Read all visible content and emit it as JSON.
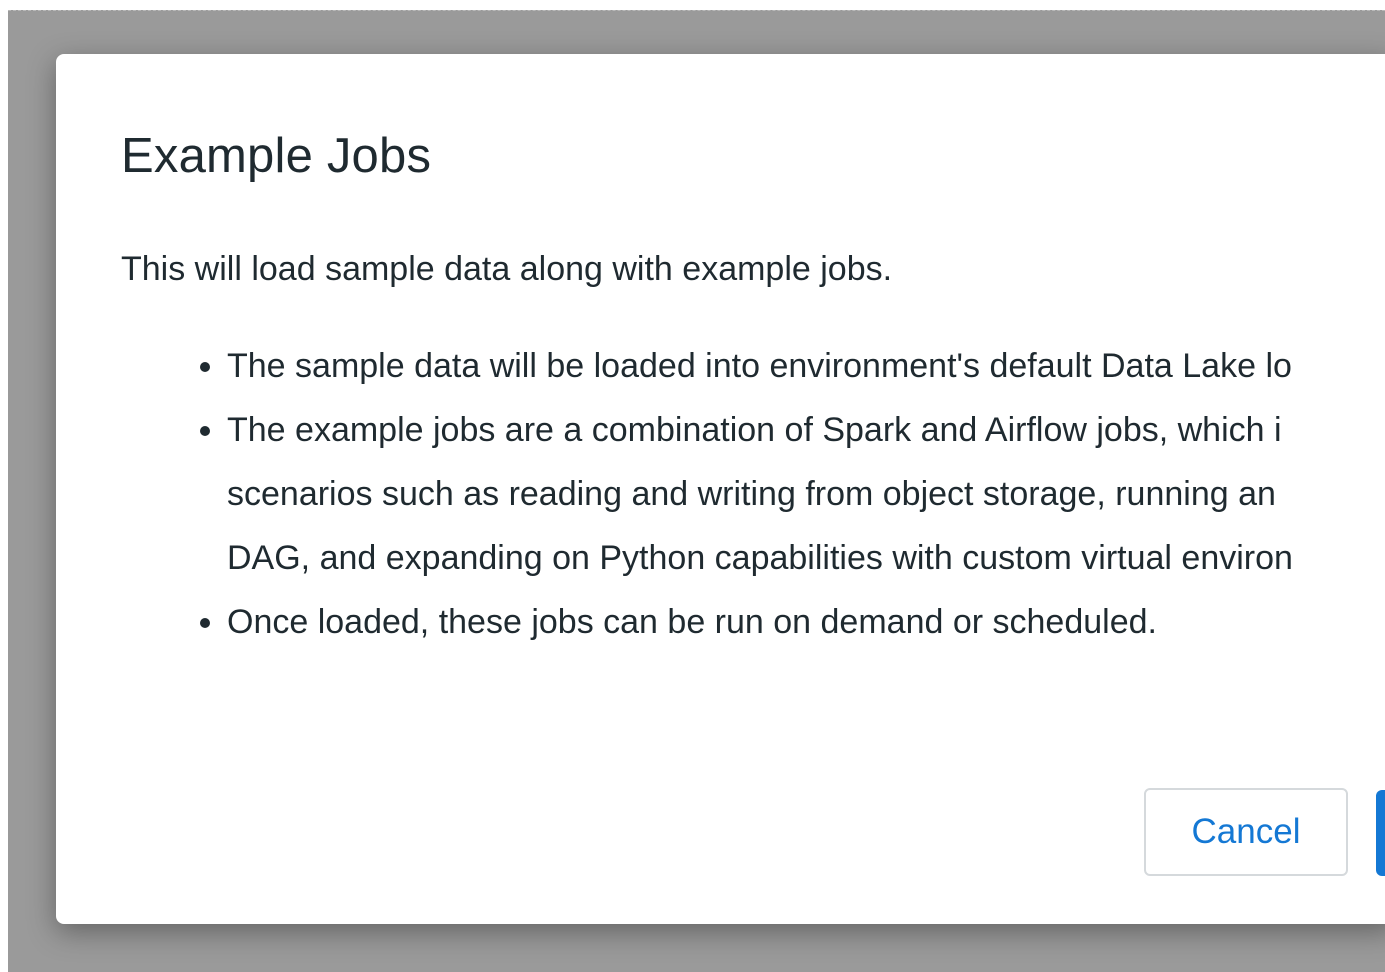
{
  "dialog": {
    "title": "Example Jobs",
    "intro": "This will load sample data along with example jobs.",
    "bullets": [
      {
        "lines": [
          "The sample data will be loaded into environment's default Data Lake lo"
        ]
      },
      {
        "lines": [
          "The example jobs are a combination of Spark and Airflow jobs, which i",
          "scenarios such as reading and writing from object storage, running an",
          "DAG, and expanding on Python capabilities with custom virtual environ"
        ]
      },
      {
        "lines": [
          "Once loaded, these jobs can be run on demand or scheduled."
        ]
      }
    ],
    "cancel_label": "Cancel"
  },
  "colors": {
    "backdrop": "#9a9a9a",
    "text": "#1f2a30",
    "accent": "#1478d4"
  }
}
